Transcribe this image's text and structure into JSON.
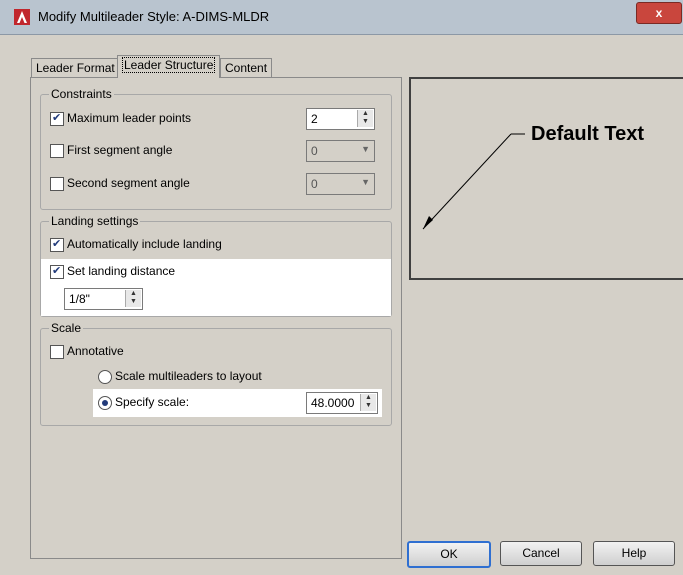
{
  "window": {
    "title": "Modify Multileader Style: A-DIMS-MLDR",
    "close_label": "x"
  },
  "tabs": [
    {
      "label": "Leader Format"
    },
    {
      "label": "Leader Structure"
    },
    {
      "label": "Content"
    }
  ],
  "constraints": {
    "legend": "Constraints",
    "max_leader_points": {
      "label": "Maximum leader points",
      "checked": true,
      "value": "2"
    },
    "first_segment_angle": {
      "label": "First segment angle",
      "checked": false,
      "value": "0"
    },
    "second_segment_angle": {
      "label": "Second segment angle",
      "checked": false,
      "value": "0"
    }
  },
  "landing": {
    "legend": "Landing settings",
    "auto_include": {
      "label": "Automatically include landing",
      "checked": true
    },
    "set_distance": {
      "label": "Set landing distance",
      "checked": true,
      "value": "1/8\""
    }
  },
  "scale": {
    "legend": "Scale",
    "annotative": {
      "label": "Annotative",
      "checked": false
    },
    "scale_to_layout": {
      "label": "Scale multileaders to layout",
      "selected": false
    },
    "specify_scale": {
      "label": "Specify scale:",
      "selected": true,
      "value": "48.0000"
    }
  },
  "preview": {
    "text": "Default Text"
  },
  "buttons": {
    "ok": "OK",
    "cancel": "Cancel",
    "help": "Help"
  },
  "colors": {
    "titlebar": "#b9c4cf",
    "dialog_bg": "#d4d0c8",
    "accent": "#2f6fd1",
    "close": "#c9463d"
  }
}
